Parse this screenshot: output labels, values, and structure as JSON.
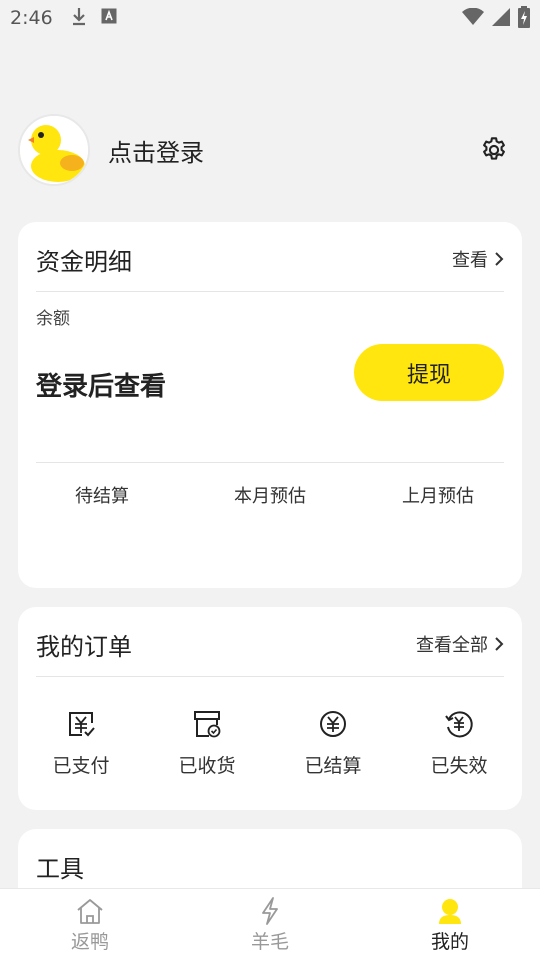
{
  "status_bar": {
    "time": "2:46",
    "icons": [
      "download-icon",
      "text-a-icon",
      "wifi-icon",
      "cell-signal-icon",
      "battery-charging-icon"
    ]
  },
  "profile": {
    "login_text": "点击登录",
    "settings_icon": "gear-icon"
  },
  "fund_card": {
    "title": "资金明细",
    "view_link": "查看",
    "balance_label": "余额",
    "balance_value": "登录后查看",
    "withdraw_button": "提现",
    "stats": [
      "待结算",
      "本月预估",
      "上月预估"
    ]
  },
  "orders_card": {
    "title": "我的订单",
    "view_all_link": "查看全部",
    "items": [
      {
        "label": "已支付",
        "icon": "paid-icon"
      },
      {
        "label": "已收货",
        "icon": "received-icon"
      },
      {
        "label": "已结算",
        "icon": "settled-icon"
      },
      {
        "label": "已失效",
        "icon": "expired-icon"
      }
    ]
  },
  "tools_card": {
    "title": "工具"
  },
  "bottom_nav": {
    "items": [
      {
        "label": "返鸭",
        "icon": "home-icon",
        "active": false
      },
      {
        "label": "羊毛",
        "icon": "lightning-icon",
        "active": false
      },
      {
        "label": "我的",
        "icon": "user-icon",
        "active": true
      }
    ]
  },
  "colors": {
    "accent": "#ffe60f",
    "background": "#f2f2f2",
    "card": "#ffffff",
    "inactive_nav": "#999999"
  }
}
